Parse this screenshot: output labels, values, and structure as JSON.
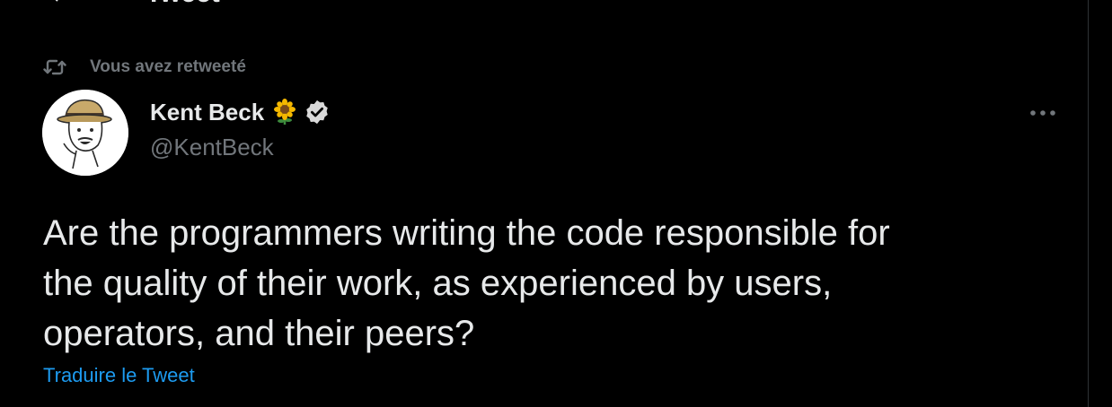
{
  "header": {
    "title": "Tweet",
    "back_icon": "arrow-left-icon"
  },
  "retweet_context": {
    "icon": "retweet-icon",
    "text": "Vous avez retweeté"
  },
  "tweet": {
    "author": {
      "name": "Kent Beck",
      "emoji": "sunflower",
      "verified": true,
      "handle": "@KentBeck"
    },
    "more_icon": "more-horizontal-icon",
    "text": "Are the programmers writing the code responsible for\nthe quality of their work, as experienced by users,\noperators, and their peers?",
    "translate_label": "Traduire le Tweet"
  },
  "colors": {
    "background": "#000000",
    "primary_text": "#e7e9ea",
    "secondary_text": "#71767b",
    "link": "#1d9bf0",
    "divider": "#2f3336"
  }
}
